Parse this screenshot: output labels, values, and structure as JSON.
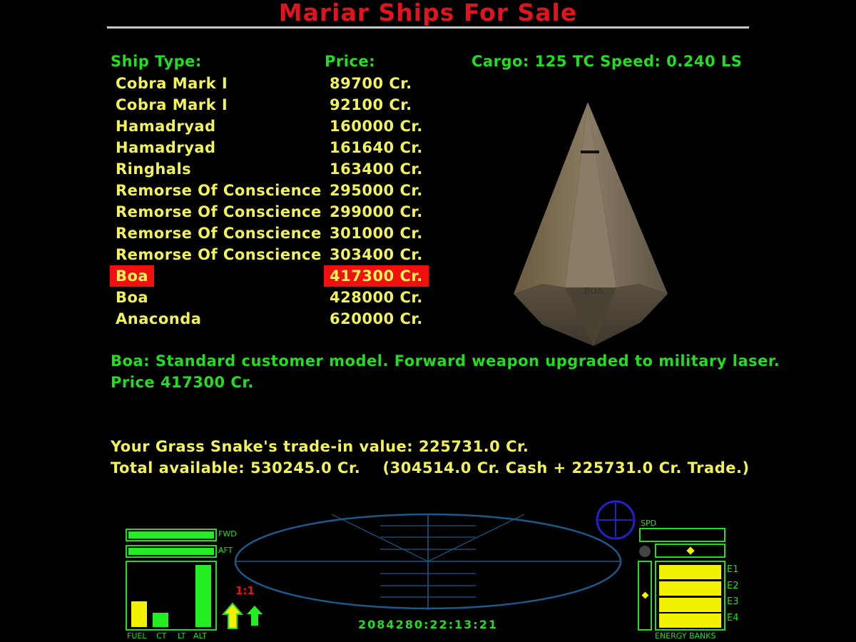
{
  "title": "Mariar Ships For Sale",
  "headers": {
    "ship_type": "Ship Type:",
    "price": "Price:",
    "stats": "Cargo: 125 TC  Speed: 0.240 LS"
  },
  "ships": [
    {
      "name": "Cobra Mark I",
      "price": "89700 Cr."
    },
    {
      "name": "Cobra Mark I",
      "price": "92100 Cr."
    },
    {
      "name": "Hamadryad",
      "price": "160000 Cr."
    },
    {
      "name": "Hamadryad",
      "price": "161640 Cr."
    },
    {
      "name": "Ringhals",
      "price": "163400 Cr."
    },
    {
      "name": "Remorse Of Conscience",
      "price": "295000 Cr."
    },
    {
      "name": "Remorse Of Conscience",
      "price": "299000 Cr."
    },
    {
      "name": "Remorse Of Conscience",
      "price": "301000 Cr."
    },
    {
      "name": "Remorse Of Conscience",
      "price": "303400 Cr."
    },
    {
      "name": "Boa",
      "price": "417300 Cr."
    },
    {
      "name": "Boa",
      "price": "428000 Cr."
    },
    {
      "name": "Anaconda",
      "price": "620000 Cr."
    }
  ],
  "selected_index": 9,
  "ship_model_label": "BOA",
  "description": {
    "line1": "Boa: Standard customer model. Forward weapon upgraded to military laser.",
    "line2": "Price 417300 Cr."
  },
  "trade": {
    "line1": "Your Grass Snake's trade-in value: 225731.0 Cr.",
    "line2": "Total available: 530245.0 Cr.    (304514.0 Cr. Cash + 225731.0 Cr. Trade.)"
  },
  "hud": {
    "fwd_label": "FWD",
    "aft_label": "AFT",
    "fuel_label": "FUEL",
    "ct_label": "CT",
    "lt_label": "LT",
    "alt_label": "ALT",
    "time_accel": "1:1",
    "clock": "2084280:22:13:21",
    "spd_label": "SPD",
    "energy_label": "ENERGY BANKS",
    "banks": [
      "E1",
      "E2",
      "E3",
      "E4"
    ],
    "fwd_shield": 1.0,
    "aft_shield": 1.0,
    "fuel": 0.4,
    "cabin_temp": 0.22,
    "laser_temp": 0.0,
    "altitude": 0.97
  },
  "colors": {
    "title": "#e0141e",
    "header": "#22dd22",
    "list_text": "#f2f25a",
    "selection": "#f01010",
    "scanner": "#1a5a8a",
    "compass": "#2222cc"
  }
}
